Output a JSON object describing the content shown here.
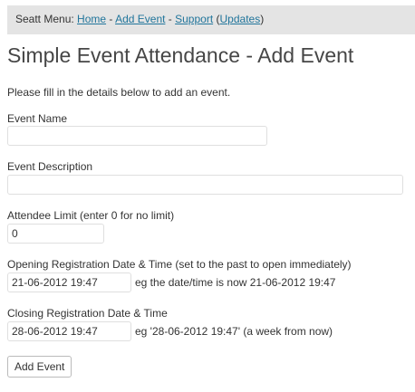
{
  "menu": {
    "prefix": "Seatt Menu: ",
    "home": "Home",
    "sep1": " - ",
    "add_event": "Add Event",
    "sep2": " - ",
    "support": "Support",
    "paren_open": " (",
    "updates": "Updates",
    "paren_close": ")"
  },
  "page": {
    "title": "Simple Event Attendance - Add Event",
    "intro": "Please fill in the details below to add an event."
  },
  "form": {
    "event_name_label": "Event Name",
    "event_name_value": "",
    "event_description_label": "Event Description",
    "event_description_value": "",
    "attendee_limit_label": "Attendee Limit (enter 0 for no limit)",
    "attendee_limit_value": "0",
    "opening_label": "Opening Registration Date & Time (set to the past to open immediately)",
    "opening_value": "21-06-2012 19:47",
    "opening_hint": "eg the date/time is now 21-06-2012 19:47",
    "closing_label": "Closing Registration Date & Time",
    "closing_value": "28-06-2012 19:47",
    "closing_hint": "eg '28-06-2012 19:47' (a week from now)",
    "submit_label": "Add Event"
  },
  "colors": {
    "menu_background": "#e4e4e4",
    "link": "#21759b",
    "title": "#464646",
    "text": "#333333"
  }
}
